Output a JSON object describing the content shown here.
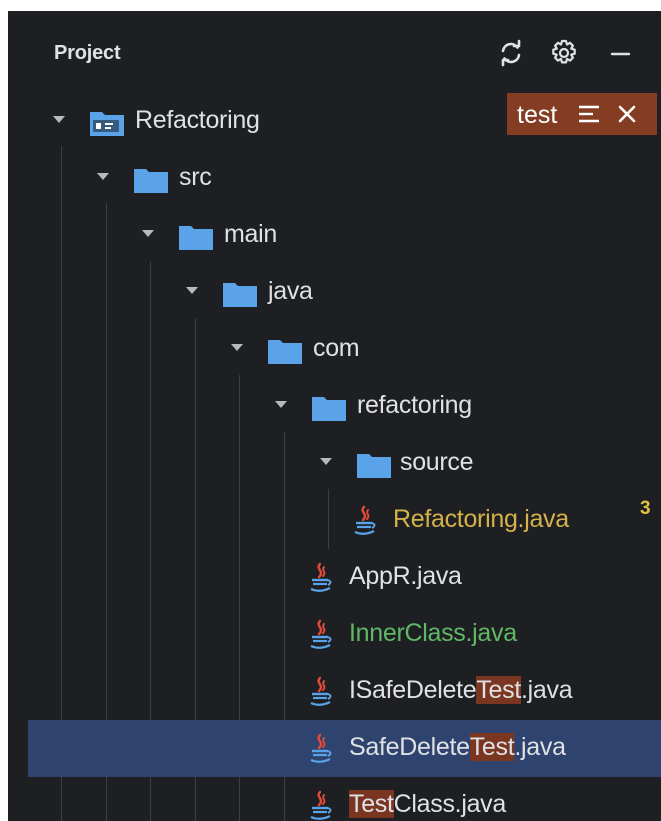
{
  "header": {
    "title": "Project",
    "icons": [
      "sync-icon",
      "gear-icon",
      "minimize-icon"
    ]
  },
  "filter": {
    "text": "test",
    "icons": [
      "filter-options-icon",
      "close-icon"
    ]
  },
  "tree": [
    {
      "label": "Refactoring",
      "type": "module"
    },
    {
      "label": "src",
      "type": "folder"
    },
    {
      "label": "main",
      "type": "folder"
    },
    {
      "label": "java",
      "type": "folder"
    },
    {
      "label": "com",
      "type": "folder"
    },
    {
      "label": "refactoring",
      "type": "folder"
    },
    {
      "label": "source",
      "type": "folder"
    },
    {
      "label": "Refactoring.java",
      "type": "java",
      "status": "modified",
      "badge": "3"
    },
    {
      "label": "AppR.java",
      "type": "java"
    },
    {
      "label": "InnerClass.java",
      "type": "java",
      "status": "added"
    },
    {
      "label_prefix": "ISafeDelete",
      "label_match": "Test",
      "label_suffix": ".java",
      "type": "java"
    },
    {
      "label_prefix": "SafeDelete",
      "label_match": "Test",
      "label_suffix": ".java",
      "type": "java",
      "selected": true
    },
    {
      "label_prefix": "",
      "label_match": "Test",
      "label_suffix": "Class.java",
      "type": "java"
    }
  ],
  "colors": {
    "background": "#1e1f22",
    "selection": "#2e436e",
    "search_highlight": "#7a3620",
    "filter_tag": "#843d23",
    "modified_text": "#d5b249",
    "added_text": "#5fb865",
    "folder_icon": "#5aa3e8"
  }
}
